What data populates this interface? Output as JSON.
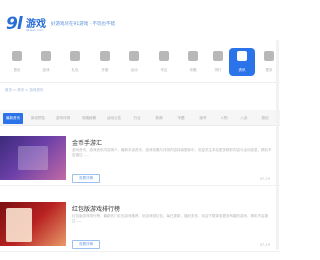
{
  "header": {
    "logo_mark": "9l",
    "logo_text": "游戏",
    "logo_sub": "91wan.com",
    "slogan": "好游戏尽在91游戏 · 不玩也不错"
  },
  "nav": {
    "items": [
      {
        "label": "首页",
        "icon": "home-icon"
      },
      {
        "label": "游戏",
        "icon": "gamepad-icon"
      },
      {
        "label": "礼包",
        "icon": "gift-icon"
      },
      {
        "label": "开服",
        "icon": "server-icon"
      },
      {
        "label": "活动",
        "icon": "calendar-icon"
      },
      {
        "label": "专区",
        "icon": "grid-icon"
      },
      {
        "label": "攻略",
        "icon": "book-icon"
      },
      {
        "label": "排行",
        "icon": "chart-icon"
      },
      {
        "label": "资讯",
        "icon": "news-icon"
      },
      {
        "label": "更多",
        "icon": "more-icon"
      }
    ],
    "active_index": 8
  },
  "breadcrumb": "首页 > 资讯 > 游戏资讯",
  "tabs": {
    "items": [
      "最新资讯",
      "新游预告",
      "游戏评测",
      "攻略秘籍",
      "活动公告",
      "行业",
      "新闻",
      "专题",
      "版号",
      "人物",
      "八卦",
      "原创"
    ],
    "active_index": 0
  },
  "articles": [
    {
      "title": "金币手游汇",
      "desc": "游戏资讯，游戏资讯内容简介，最新手游资讯，游戏攻略与评测内容持续更新中，欢迎关注本站更多精彩内容与活动信息，精彩不容错过……",
      "button": "查看详情",
      "date": "07-19"
    },
    {
      "title": "红包版游戏排行榜",
      "desc": "红包版游戏排行榜，最新热门红包游戏推荐，玩游戏领红包，每日更新，福利多多，欢迎下载体验更多有趣的游戏，精彩不容错过……",
      "button": "查看详情",
      "date": "07-19"
    }
  ]
}
